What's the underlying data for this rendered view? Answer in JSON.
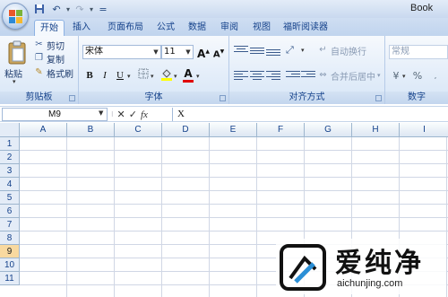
{
  "window": {
    "title": "Book"
  },
  "quick_access": {
    "save_icon": "save-icon",
    "undo_icon": "undo-icon",
    "redo_icon": "redo-icon",
    "customize": "="
  },
  "tabs": [
    {
      "label": "开始",
      "active": true
    },
    {
      "label": "插入"
    },
    {
      "label": "页面布局"
    },
    {
      "label": "公式"
    },
    {
      "label": "数据"
    },
    {
      "label": "审阅"
    },
    {
      "label": "视图"
    },
    {
      "label": "福昕阅读器"
    }
  ],
  "clipboard": {
    "paste": "粘贴",
    "cut": "剪切",
    "copy": "复制",
    "format_painter": "格式刷",
    "group": "剪贴板"
  },
  "font": {
    "name": "宋体",
    "size": "11",
    "bold": "B",
    "italic": "I",
    "underline": "U",
    "color_a": "A",
    "grow": "A",
    "shrink": "A",
    "group": "字体"
  },
  "alignment": {
    "wrap": "自动换行",
    "merge": "合并后居中",
    "group": "对齐方式"
  },
  "number": {
    "format": "常规",
    "percent": "%",
    "group": "数字"
  },
  "formula_bar": {
    "name_box": "M9",
    "content": "X",
    "cancel": "✕",
    "enter": "✓",
    "fx": "fx"
  },
  "columns": [
    "A",
    "B",
    "C",
    "D",
    "E",
    "F",
    "G",
    "H",
    "I"
  ],
  "rows": [
    "1",
    "2",
    "3",
    "4",
    "5",
    "6",
    "7",
    "8",
    "9",
    "10",
    "11"
  ],
  "selected_row": "9",
  "watermark": {
    "text": "爱纯净",
    "url": "aichunjing.com"
  },
  "colors": {
    "accent": "#15428b",
    "ribbon_border": "#8db2e3",
    "selected_row": "#f9d99f"
  }
}
